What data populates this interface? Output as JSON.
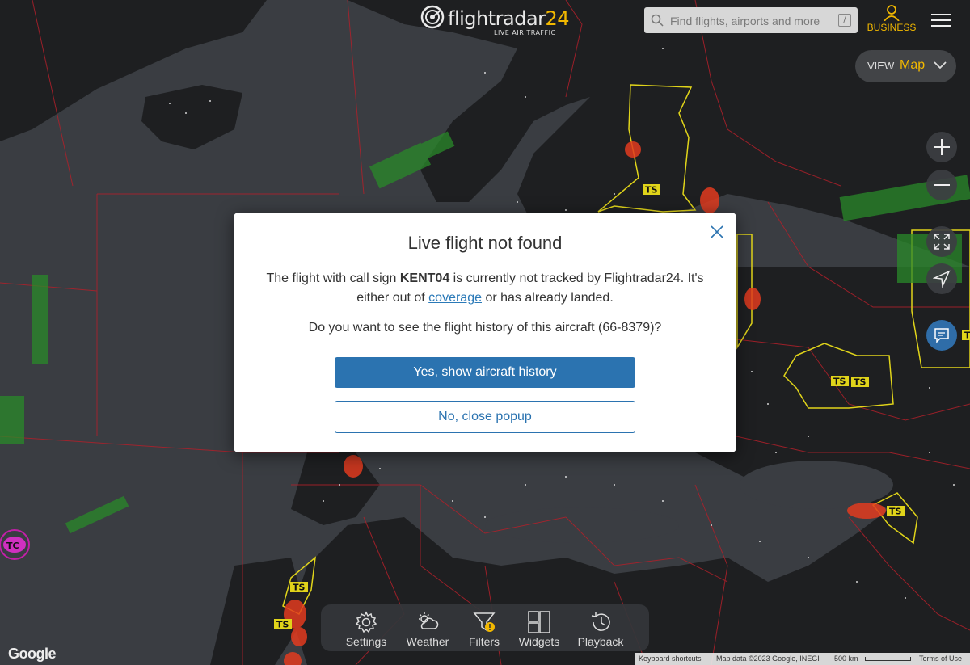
{
  "header": {
    "logo_text": "flightradar",
    "logo_num": "24",
    "logo_sub": "LIVE AIR TRAFFIC",
    "search_placeholder": "Find flights, airports and more",
    "search_shortcut": "/",
    "business_label": "BUSINESS"
  },
  "view": {
    "label": "VIEW",
    "value": "Map"
  },
  "modal": {
    "title": "Live flight not found",
    "text_before": "The flight with call sign ",
    "callsign": "KENT04",
    "text_after": " is currently not tracked by Flightradar24. It's either out of ",
    "link": "coverage",
    "text_end": " or has already landed.",
    "question": "Do you want to see the flight history of this aircraft (66-8379)?",
    "primary_button": "Yes, show aircraft history",
    "secondary_button": "No, close popup"
  },
  "toolbar": {
    "items": [
      {
        "label": "Settings"
      },
      {
        "label": "Weather"
      },
      {
        "label": "Filters"
      },
      {
        "label": "Widgets"
      },
      {
        "label": "Playback"
      }
    ]
  },
  "map": {
    "storm_labels": [
      "TS",
      "TS",
      "TS",
      "TS",
      "TS",
      "TS",
      "TS",
      "TC"
    ],
    "google_logo": "Google",
    "attribution": {
      "shortcuts": "Keyboard shortcuts",
      "data": "Map data ©2023 Google, INEGI",
      "scale": "500 km",
      "terms": "Terms of Use"
    }
  },
  "colors": {
    "accent": "#f2b800",
    "primary_button": "#2b73b0",
    "map_land": "#1e1f21",
    "map_sea": "#3a3d42",
    "border": "#b0202a",
    "storm_outline": "#e0d41a"
  }
}
